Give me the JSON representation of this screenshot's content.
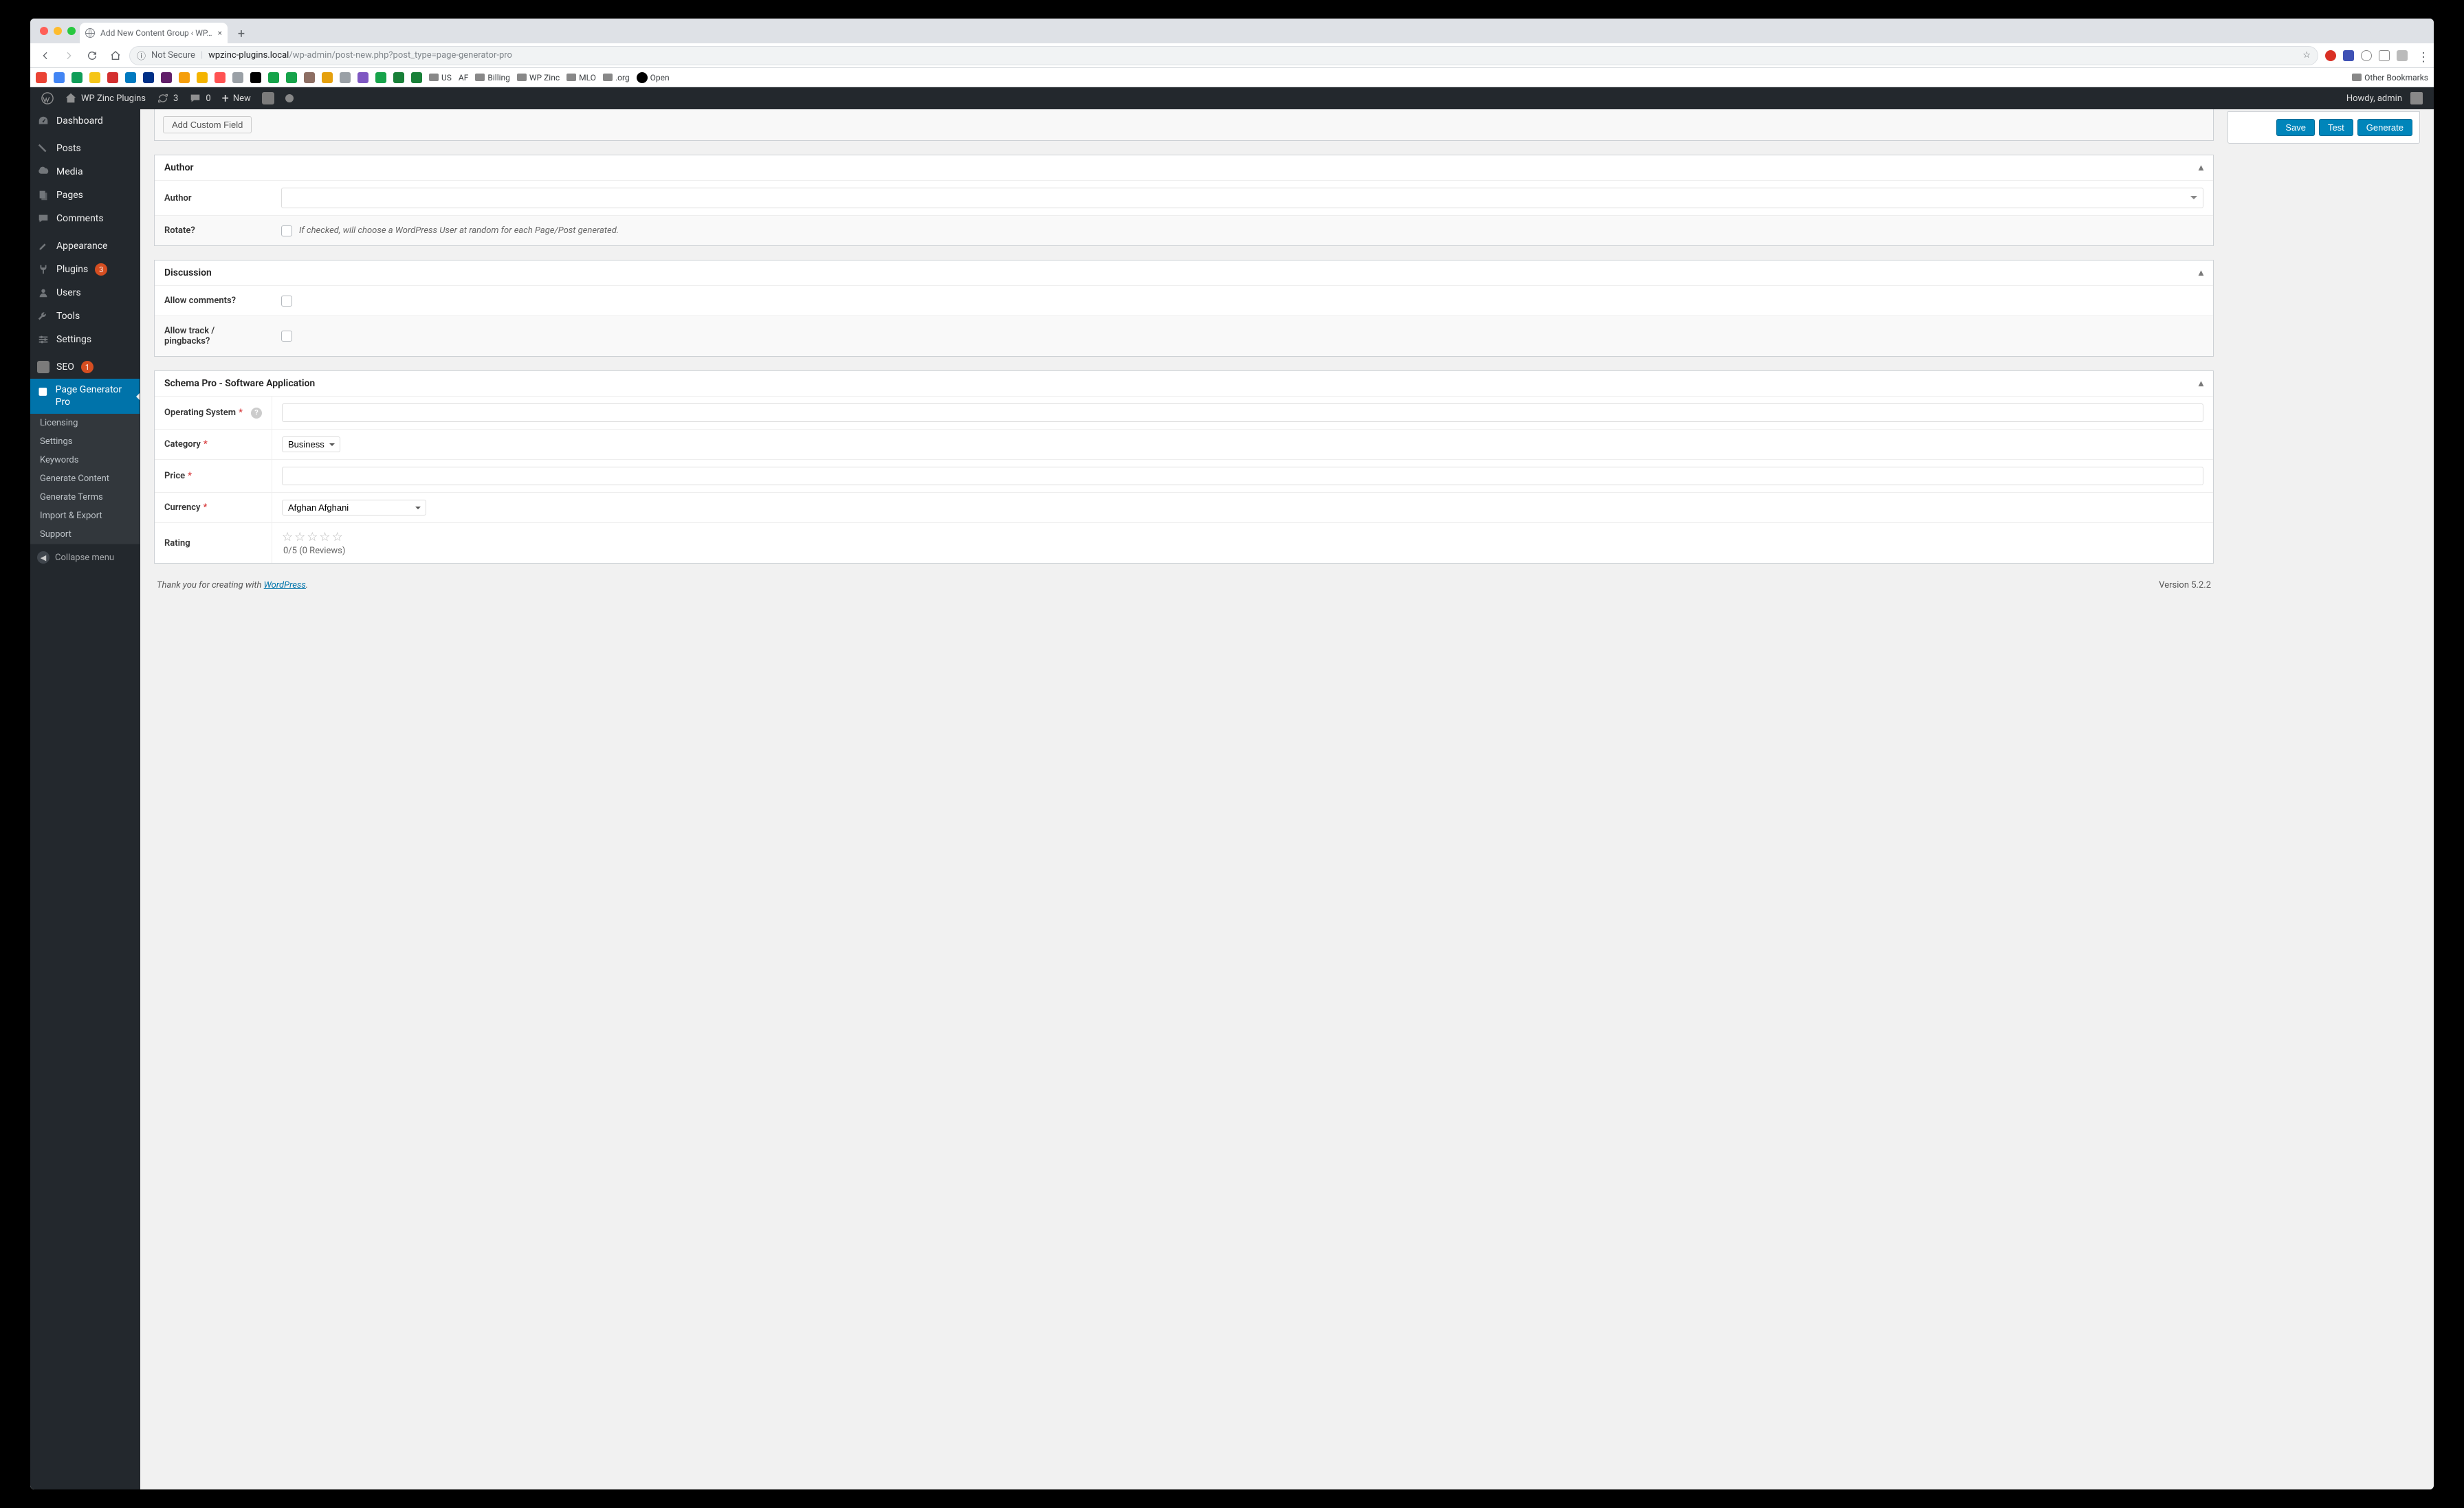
{
  "browser": {
    "tab_title": "Add New Content Group ‹ WP…",
    "url_insecure_label": "Not Secure",
    "url_host": "wpzinc-plugins.local",
    "url_path": "/wp-admin/post-new.php?post_type=page-generator-pro",
    "other_bookmarks": "Other Bookmarks",
    "bookmarks": [
      {
        "name": "gmail",
        "label": "",
        "color": "#ea4335"
      },
      {
        "name": "gcal",
        "label": "",
        "color": "#4285f4"
      },
      {
        "name": "gdrive",
        "label": "",
        "color": "#0f9d58"
      },
      {
        "name": "y1",
        "label": "",
        "color": "#f5c518"
      },
      {
        "name": "red",
        "label": "",
        "color": "#d32f2f"
      },
      {
        "name": "trello",
        "label": "",
        "color": "#0079bf"
      },
      {
        "name": "paypal",
        "label": "",
        "color": "#003087"
      },
      {
        "name": "slack",
        "label": "",
        "color": "#611f69"
      },
      {
        "name": "y2",
        "label": "",
        "color": "#f59e0b"
      },
      {
        "name": "analytics",
        "label": "",
        "color": "#f4b400"
      },
      {
        "name": "maps",
        "label": "",
        "color": "#ff5252"
      },
      {
        "name": "grey1",
        "label": "",
        "color": "#9aa0a6"
      },
      {
        "name": "github",
        "label": "",
        "color": "#000"
      },
      {
        "name": "nginx",
        "label": "",
        "color": "#16a34a"
      },
      {
        "name": "green2",
        "label": "",
        "color": "#16a34a"
      },
      {
        "name": "brown",
        "label": "",
        "color": "#8d6e63"
      },
      {
        "name": "plex",
        "label": "",
        "color": "#e5a00d"
      },
      {
        "name": "grey2",
        "label": "",
        "color": "#9aa0a6"
      },
      {
        "name": "purple",
        "label": "",
        "color": "#7e57c2"
      },
      {
        "name": "green3",
        "label": "",
        "color": "#16a34a"
      },
      {
        "name": "sheets",
        "label": "",
        "color": "#188038"
      },
      {
        "name": "sheets2",
        "label": "",
        "color": "#188038"
      },
      {
        "name": "us",
        "label": "US",
        "folder": true
      },
      {
        "name": "af",
        "label": "AF",
        "folder": false,
        "text_only": true
      },
      {
        "name": "billing",
        "label": "Billing",
        "folder": true
      },
      {
        "name": "wpzinc",
        "label": "WP Zinc",
        "folder": true
      },
      {
        "name": "mlo",
        "label": "MLO",
        "folder": true
      },
      {
        "name": "org",
        "label": ".org",
        "folder": true
      },
      {
        "name": "open",
        "label": "Open",
        "gh": true
      }
    ]
  },
  "adminbar": {
    "site": "WP Zinc Plugins",
    "updates": "3",
    "comments": "0",
    "new": "New",
    "howdy": "Howdy, admin"
  },
  "sidebar": {
    "dashboard": "Dashboard",
    "posts": "Posts",
    "media": "Media",
    "pages": "Pages",
    "comments": "Comments",
    "appearance": "Appearance",
    "plugins": "Plugins",
    "plugins_count": "3",
    "users": "Users",
    "tools": "Tools",
    "settings": "Settings",
    "seo": "SEO",
    "seo_count": "1",
    "pgen": "Page Generator Pro",
    "submenu": [
      "Licensing",
      "Settings",
      "Keywords",
      "Generate Content",
      "Generate Terms",
      "Import & Export",
      "Support"
    ],
    "collapse": "Collapse menu"
  },
  "actions": {
    "save": "Save",
    "test": "Test",
    "generate": "Generate",
    "add_cf": "Add Custom Field"
  },
  "author_box": {
    "title": "Author",
    "author_label": "Author",
    "rotate_label": "Rotate?",
    "rotate_desc": "If checked, will choose a WordPress User at random for each Page/Post generated."
  },
  "discussion_box": {
    "title": "Discussion",
    "allow_comments": "Allow comments?",
    "allow_pings": "Allow track / pingbacks?"
  },
  "schema_box": {
    "title": "Schema Pro - Software Application",
    "os": "Operating System",
    "category": "Category",
    "category_value": "Business",
    "price": "Price",
    "currency": "Currency",
    "currency_value": "Afghan Afghani",
    "rating": "Rating",
    "rating_info": "0/5 (0 Reviews)"
  },
  "footer": {
    "thank_pre": "Thank you for creating with ",
    "wp": "WordPress",
    "version": "Version 5.2.2"
  }
}
